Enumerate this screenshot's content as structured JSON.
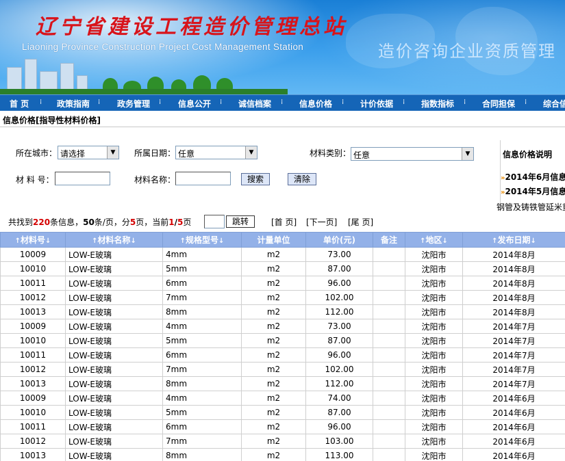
{
  "banner": {
    "title": "辽宁省建设工程造价管理总站",
    "subtitle": "Liaoning Province Construction Project Cost Management Station",
    "right_text": "造价咨询企业资质管理"
  },
  "nav": [
    "首 页",
    "政策指南",
    "政务管理",
    "信息公开",
    "诚信档案",
    "信息价格",
    "计价依据",
    "指数指标",
    "合同担保",
    "综合信"
  ],
  "page_heading": "信息价格[指导性材料价格]",
  "filters": {
    "city_label": "所在城市：",
    "city_value": "请选择",
    "date_label": "所属日期：",
    "date_value": "任意",
    "category_label": "材料类别：",
    "category_value": "任意",
    "code_label": "材 料 号：",
    "name_label": "材料名称：",
    "search_label": "搜索",
    "clear_label": "清除"
  },
  "side": {
    "title": "信息价格说明",
    "items": [
      "2014年6月信息",
      "2014年5月信息"
    ],
    "scroll_text": "钢管及铸铁管延米重"
  },
  "pager": {
    "found_prefix": "共找到",
    "total": "220",
    "mid1": "条信息，",
    "per_page": "50",
    "mid2": "条/页，分",
    "pages": "5",
    "mid3": "页，当前",
    "current": "1",
    "sep": "/",
    "pages2": "5",
    "mid4": "页",
    "jump_label": "跳转",
    "first": "[首 页]",
    "next": "[下一页]",
    "last": "[尾 页]"
  },
  "table": {
    "columns": [
      "材料号",
      "材料名称",
      "规格型号",
      "计量单位",
      "单价(元)",
      "备注",
      "地区",
      "发布日期"
    ],
    "sortable": [
      true,
      true,
      true,
      false,
      false,
      false,
      true,
      true
    ],
    "rows": [
      [
        "10009",
        "LOW-E玻璃",
        "4mm",
        "m2",
        "73.00",
        "",
        "沈阳市",
        "2014年8月"
      ],
      [
        "10010",
        "LOW-E玻璃",
        "5mm",
        "m2",
        "87.00",
        "",
        "沈阳市",
        "2014年8月"
      ],
      [
        "10011",
        "LOW-E玻璃",
        "6mm",
        "m2",
        "96.00",
        "",
        "沈阳市",
        "2014年8月"
      ],
      [
        "10012",
        "LOW-E玻璃",
        "7mm",
        "m2",
        "102.00",
        "",
        "沈阳市",
        "2014年8月"
      ],
      [
        "10013",
        "LOW-E玻璃",
        "8mm",
        "m2",
        "112.00",
        "",
        "沈阳市",
        "2014年8月"
      ],
      [
        "10009",
        "LOW-E玻璃",
        "4mm",
        "m2",
        "73.00",
        "",
        "沈阳市",
        "2014年7月"
      ],
      [
        "10010",
        "LOW-E玻璃",
        "5mm",
        "m2",
        "87.00",
        "",
        "沈阳市",
        "2014年7月"
      ],
      [
        "10011",
        "LOW-E玻璃",
        "6mm",
        "m2",
        "96.00",
        "",
        "沈阳市",
        "2014年7月"
      ],
      [
        "10012",
        "LOW-E玻璃",
        "7mm",
        "m2",
        "102.00",
        "",
        "沈阳市",
        "2014年7月"
      ],
      [
        "10013",
        "LOW-E玻璃",
        "8mm",
        "m2",
        "112.00",
        "",
        "沈阳市",
        "2014年7月"
      ],
      [
        "10009",
        "LOW-E玻璃",
        "4mm",
        "m2",
        "74.00",
        "",
        "沈阳市",
        "2014年6月"
      ],
      [
        "10010",
        "LOW-E玻璃",
        "5mm",
        "m2",
        "87.00",
        "",
        "沈阳市",
        "2014年6月"
      ],
      [
        "10011",
        "LOW-E玻璃",
        "6mm",
        "m2",
        "96.00",
        "",
        "沈阳市",
        "2014年6月"
      ],
      [
        "10012",
        "LOW-E玻璃",
        "7mm",
        "m2",
        "103.00",
        "",
        "沈阳市",
        "2014年6月"
      ],
      [
        "10013",
        "LOW-E玻璃",
        "8mm",
        "m2",
        "113.00",
        "",
        "沈阳市",
        "2014年6月"
      ]
    ]
  },
  "colors": {
    "nav_bg": "#1565b7",
    "header_bg": "#93b1e8",
    "title_red": "#d8141b",
    "count_red": "#d40000"
  }
}
